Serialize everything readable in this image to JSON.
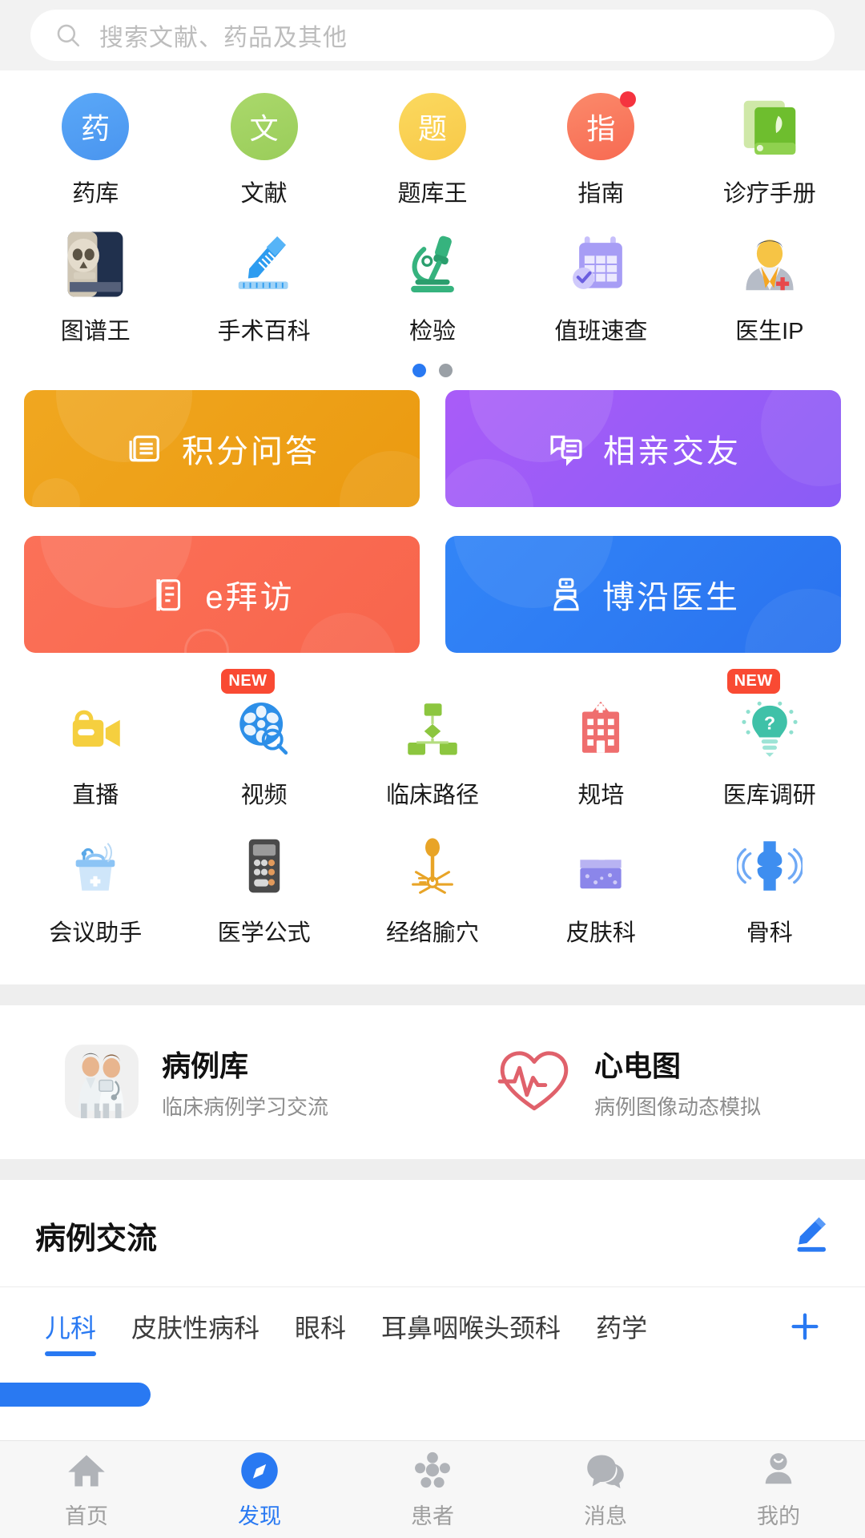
{
  "search": {
    "placeholder": "搜索文献、药品及其他",
    "icon": "search-icon"
  },
  "quick_grid_page1": [
    {
      "label": "药库",
      "icon": "pill-circle-icon",
      "glyph": "药",
      "color": "#4d9ef6",
      "shape": "circle",
      "badge": null
    },
    {
      "label": "文献",
      "icon": "literature-circle-icon",
      "glyph": "文",
      "color": "#a3d162",
      "shape": "circle",
      "badge": null
    },
    {
      "label": "题库王",
      "icon": "quiz-circle-icon",
      "glyph": "题",
      "color": "#fad055",
      "shape": "circle",
      "badge": null
    },
    {
      "label": "指南",
      "icon": "guideline-circle-icon",
      "glyph": "指",
      "color": "#fa7a5e",
      "shape": "circle",
      "badge": "dot"
    },
    {
      "label": "诊疗手册",
      "icon": "green-book-icon",
      "glyph": "",
      "color": "#7dc143",
      "shape": "book",
      "badge": null
    }
  ],
  "quick_grid_page1_row2": [
    {
      "label": "图谱王",
      "icon": "skull-atlas-icon",
      "color": "#2b3a55"
    },
    {
      "label": "手术百科",
      "icon": "scalpel-icon",
      "color": "#2d9cf0"
    },
    {
      "label": "检验",
      "icon": "microscope-icon",
      "color": "#36b37e"
    },
    {
      "label": "值班速查",
      "icon": "duty-calendar-icon",
      "color": "#9b8cf2"
    },
    {
      "label": "医生IP",
      "icon": "doctor-portrait-icon",
      "color": "#f2b949"
    }
  ],
  "carousel": {
    "pages": 2,
    "active_index": 0
  },
  "banners": [
    {
      "label": "积分问答",
      "icon": "points-qa-icon",
      "color_from": "#f0a31b",
      "color_to": "#eb9b12"
    },
    {
      "label": "相亲交友",
      "icon": "matchmaking-icon",
      "color_from": "#a855f7",
      "color_to": "#8b5cf6"
    },
    {
      "label": "e拜访",
      "icon": "evisit-icon",
      "color_from": "#fb6d54",
      "color_to": "#f9684f"
    },
    {
      "label": "博沿医生",
      "icon": "boyan-doctor-icon",
      "color_from": "#2f7ef5",
      "color_to": "#2a74ef"
    }
  ],
  "tools_row1": [
    {
      "label": "直播",
      "icon": "live-camera-icon",
      "badge": null,
      "color": "#f5cf3f"
    },
    {
      "label": "视频",
      "icon": "film-reel-icon",
      "badge": "NEW",
      "color": "#2d8fe8"
    },
    {
      "label": "临床路径",
      "icon": "clinical-path-icon",
      "badge": null,
      "color": "#8cc63f"
    },
    {
      "label": "规培",
      "icon": "hospital-icon",
      "badge": null,
      "color": "#ef6e6e"
    },
    {
      "label": "医库调研",
      "icon": "bulb-survey-icon",
      "badge": "NEW",
      "color": "#3fc1a8"
    }
  ],
  "tools_row2": [
    {
      "label": "会议助手",
      "icon": "podium-icon",
      "badge": null,
      "color": "#8cc4f5"
    },
    {
      "label": "医学公式",
      "icon": "calculator-icon",
      "badge": null,
      "color": "#4a4a4a"
    },
    {
      "label": "经络腧穴",
      "icon": "acupuncture-icon",
      "badge": null,
      "color": "#e8a427"
    },
    {
      "label": "皮肤科",
      "icon": "skin-layer-icon",
      "badge": null,
      "color": "#8b86ea"
    },
    {
      "label": "骨科",
      "icon": "bone-joint-icon",
      "badge": null,
      "color": "#3e8ef0"
    }
  ],
  "features": [
    {
      "title": "病例库",
      "subtitle": "临床病例学习交流",
      "icon": "two-doctors-icon"
    },
    {
      "title": "心电图",
      "subtitle": "病例图像动态模拟",
      "icon": "heart-ecg-icon"
    }
  ],
  "case_exchange": {
    "title": "病例交流",
    "edit_icon": "pencil-edit-icon",
    "add_icon": "plus-icon",
    "tabs": [
      {
        "label": "儿科",
        "active": true
      },
      {
        "label": "皮肤性病科",
        "active": false
      },
      {
        "label": "眼科",
        "active": false
      },
      {
        "label": "耳鼻咽喉头颈科",
        "active": false
      },
      {
        "label": "药学",
        "active": false
      }
    ]
  },
  "bottom_nav": [
    {
      "label": "首页",
      "icon": "home-icon",
      "active": false
    },
    {
      "label": "发现",
      "icon": "compass-icon",
      "active": true
    },
    {
      "label": "患者",
      "icon": "patients-icon",
      "active": false
    },
    {
      "label": "消息",
      "icon": "message-icon",
      "active": false
    },
    {
      "label": "我的",
      "icon": "profile-icon",
      "active": false
    }
  ],
  "colors": {
    "accent": "#2979f2",
    "badge_red": "#f5333f",
    "new_badge": "#f94a33",
    "page_bg": "#ffffff",
    "divider": "#eeeeee"
  }
}
